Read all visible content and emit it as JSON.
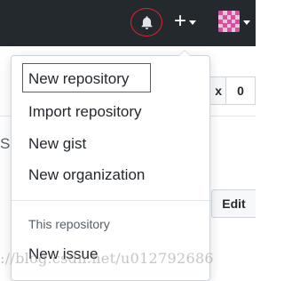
{
  "header": {
    "notifications_icon": "bell-icon",
    "create_icon": "plus-icon",
    "profile_icon": "avatar"
  },
  "background": {
    "counter_label": "x",
    "counter_value": "0",
    "left_fragment": "S",
    "edit_label": "Edit"
  },
  "dropdown": {
    "items": [
      {
        "label": "New repository"
      },
      {
        "label": "Import repository"
      },
      {
        "label": "New gist"
      },
      {
        "label": "New organization"
      }
    ],
    "section_header": "This repository",
    "section_items": [
      {
        "label": "New issue"
      }
    ]
  },
  "watermark": "://blog.csdn.net/u012792686",
  "colors": {
    "header_bg": "#24292e",
    "annotation_red": "#e3242b",
    "avatar_pink": "#d3519f"
  }
}
